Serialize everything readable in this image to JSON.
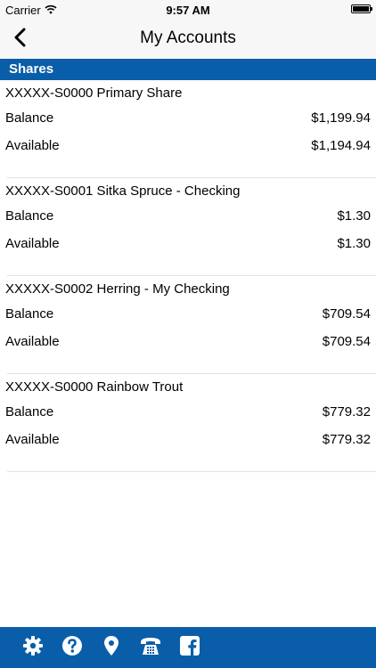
{
  "status_bar": {
    "carrier": "Carrier",
    "time": "9:57 AM"
  },
  "nav": {
    "title": "My Accounts",
    "back_icon": "chevron-left-icon"
  },
  "section": {
    "title": "Shares"
  },
  "accounts": [
    {
      "name": "XXXXX-S0000 Primary Share",
      "balance_label": "Balance",
      "balance": "$1,199.94",
      "available_label": "Available",
      "available": "$1,194.94"
    },
    {
      "name": "XXXXX-S0001 Sitka Spruce - Checking",
      "balance_label": "Balance",
      "balance": "$1.30",
      "available_label": "Available",
      "available": "$1.30"
    },
    {
      "name": "XXXXX-S0002 Herring - My Checking",
      "balance_label": "Balance",
      "balance": "$709.54",
      "available_label": "Available",
      "available": "$709.54"
    },
    {
      "name": "XXXXX-S0000 Rainbow Trout",
      "balance_label": "Balance",
      "balance": "$779.32",
      "available_label": "Available",
      "available": "$779.32"
    }
  ],
  "toolbar": {
    "icons": [
      "gear-icon",
      "help-icon",
      "location-pin-icon",
      "phone-icon",
      "facebook-icon"
    ]
  },
  "colors": {
    "brand_blue": "#0a5ea9",
    "bar_gray": "#f7f7f7",
    "divider": "#e2e2e2"
  }
}
